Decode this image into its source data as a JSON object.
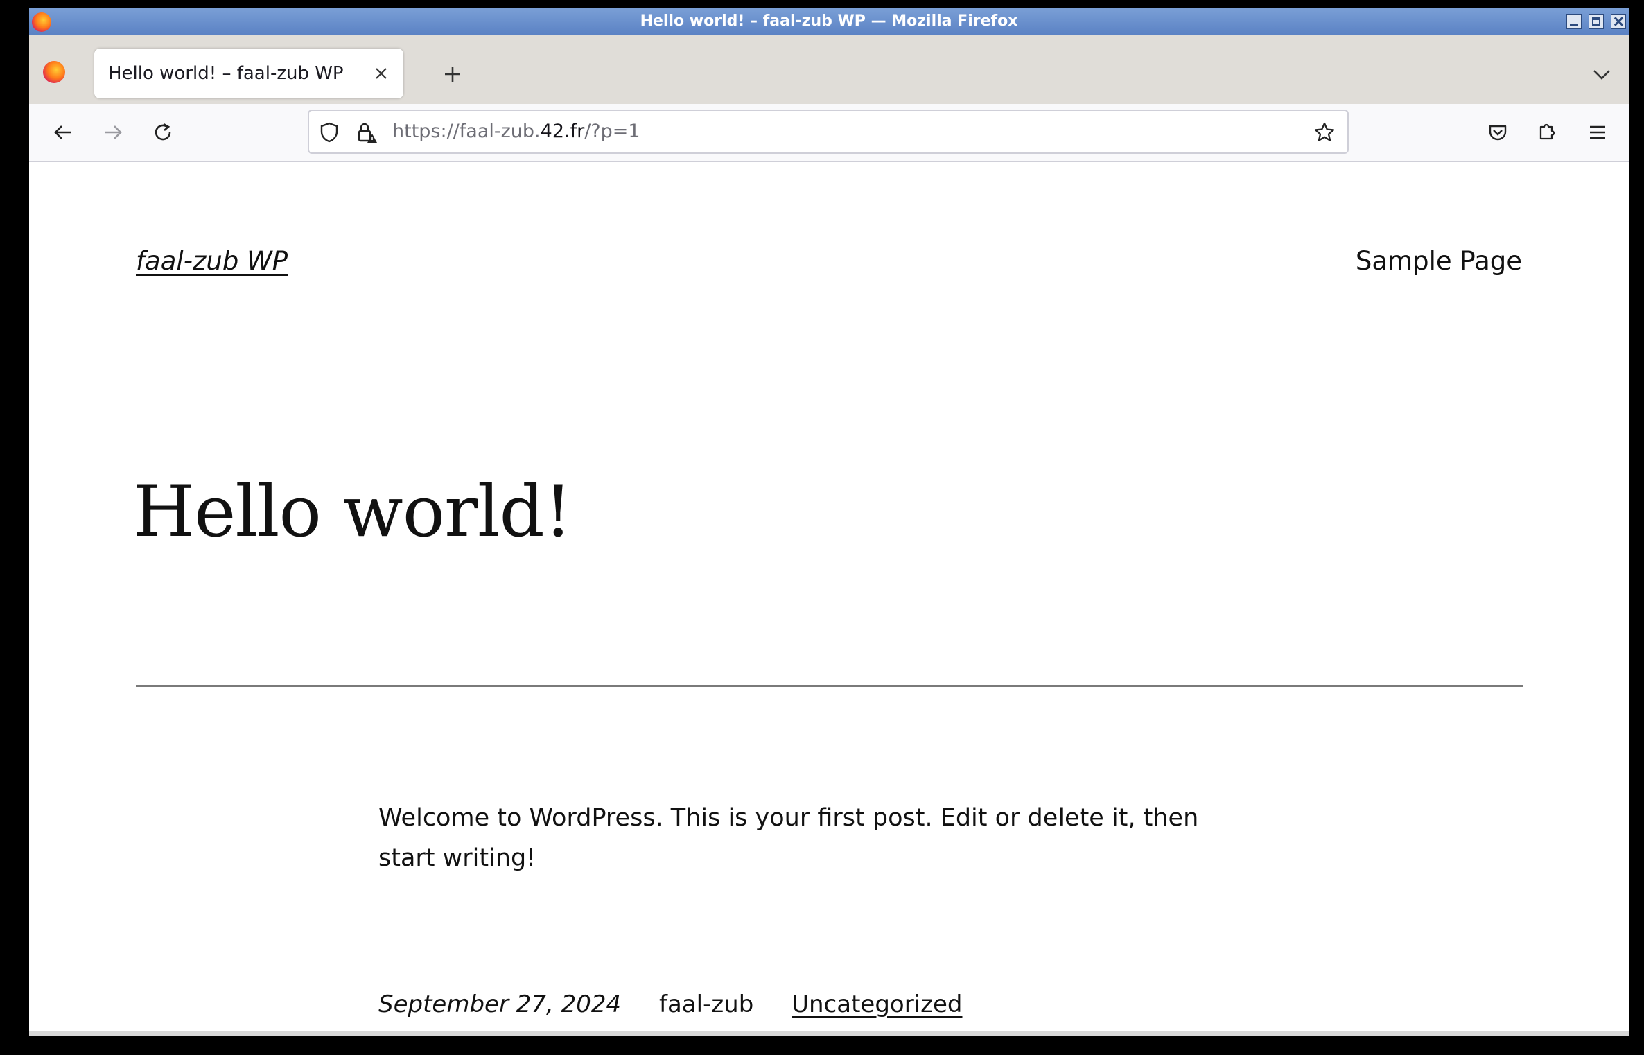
{
  "window": {
    "title": "Hello world! – faal-zub WP — Mozilla Firefox"
  },
  "tabs": [
    {
      "label": "Hello world! – faal-zub WP",
      "active": true
    }
  ],
  "urlbar": {
    "url_prefix": "https://faal-zub.",
    "url_host": "42.fr",
    "url_suffix": "/?p=1"
  },
  "icons": {
    "back": "arrow-left-icon",
    "forward": "arrow-right-icon",
    "reload": "reload-icon",
    "shield": "tracking-protection-shield-icon",
    "lock": "insecure-lock-icon",
    "bookmark": "star-icon",
    "pocket": "pocket-icon",
    "extensions": "extensions-icon",
    "menu": "hamburger-menu-icon"
  },
  "site": {
    "title": "faal-zub WP",
    "nav_items": [
      "Sample Page"
    ]
  },
  "post": {
    "title": "Hello world!",
    "content": "Welcome to WordPress. This is your first post. Edit or delete it, then start writing!",
    "date": "September 27, 2024",
    "author": "faal-zub",
    "category": "Uncategorized"
  },
  "colors": {
    "titlebar": "#5b82c4",
    "tabstrip": "#e0ddd8",
    "page_text": "#111111"
  }
}
